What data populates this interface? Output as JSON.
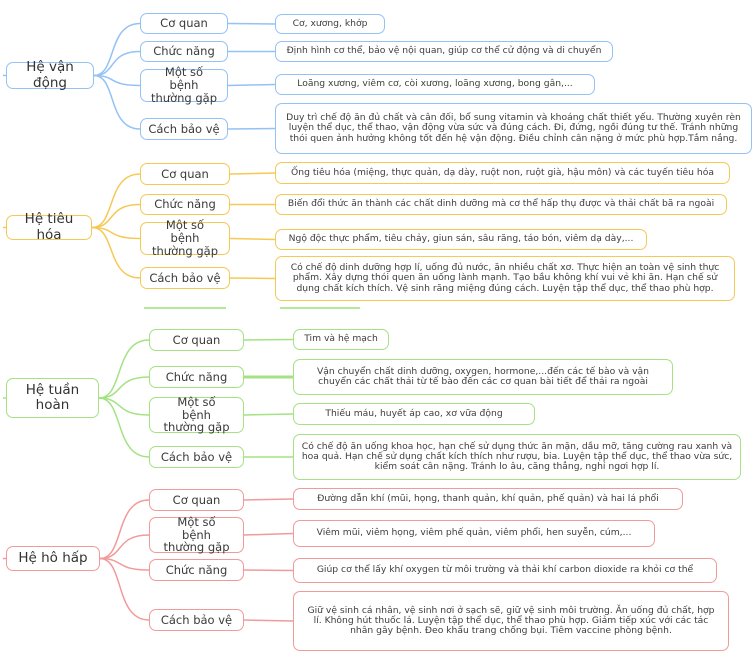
{
  "colors": {
    "he_van_dong": "#94c2f5",
    "he_tieu_hoa": "#f5c955",
    "he_tuan_hoan": "#a4e283",
    "he_ho_hap": "#f19a9a"
  },
  "systems": [
    {
      "title": "Hệ vận động",
      "color_key": "he_van_dong",
      "branches": [
        {
          "label": "Cơ quan",
          "detail": "Cơ, xương, khớp"
        },
        {
          "label": "Chức năng",
          "detail": "Định hình cơ thể, bảo vệ nội quan, giúp cơ thể cử động và di chuyển"
        },
        {
          "label": "Một số bệnh thường gặp",
          "detail": "Loãng xương, viêm cơ, còi xương, loãng xương, bong gân,..."
        },
        {
          "label": "Cách bảo vệ",
          "detail": "Duy trì chế độ ăn đủ chất và cân đối, bổ sung vitamin và khoáng chất thiết yếu. Thường xuyên rèn luyện thể dục, thể thao, vận động vừa sức và đúng cách. Đi, đứng, ngồi đúng tư thế. Tránh những thói quen ảnh hưởng không tốt đến hệ vận động. Điều chỉnh cân nặng ở mức phù hợp.Tắm nắng."
        }
      ]
    },
    {
      "title": "Hệ tiêu hóa",
      "color_key": "he_tieu_hoa",
      "branches": [
        {
          "label": "Cơ quan",
          "detail": "Ống tiêu hóa (miệng, thực quản, dạ dày, ruột non, ruột già, hậu môn) và các tuyến tiêu hóa"
        },
        {
          "label": "Chức năng",
          "detail": "Biến đổi thức ăn thành các chất dinh dưỡng mà cơ thể hấp thụ được và thải chất bã ra ngoài"
        },
        {
          "label": "Một số bệnh thường gặp",
          "detail": "Ngộ độc thực phẩm, tiêu chảy, giun sán, sâu răng, táo bón, viêm dạ dày,..."
        },
        {
          "label": "Cách bảo vệ",
          "detail": "Có chế độ dinh dưỡng hợp lí, uống đủ nước, ăn nhiều chất xơ.  Thực hiện an toàn vệ sinh thực phẩm.  Xây dựng thói quen ăn uống lành mạnh.  Tạo bầu không khí vui vẻ khi ăn. Hạn chế sử dụng chất kích thích.  Vệ sinh răng miệng đúng cách.  Luyện tập thể dục, thể thao phù hợp."
        }
      ]
    },
    {
      "title": "Hệ tuần hoàn",
      "color_key": "he_tuan_hoan",
      "branches": [
        {
          "label": "Cơ quan",
          "detail": "Tim và hệ mạch"
        },
        {
          "label": "Chức năng",
          "detail": "Vận chuyển chất dinh dưỡng, oxygen, hormone,...đến các tế bào và vận chuyển các chất thải từ tế bào đến các cơ quan bài tiết để thải ra ngoài"
        },
        {
          "label": "Một số bệnh thường gặp",
          "detail": "Thiếu máu, huyết áp cao, xơ vữa động"
        },
        {
          "label": "Cách bảo vệ",
          "detail": "Có chế độ ăn uống khoa học, hạn chế sử dụng thức ăn mặn, dầu mỡ, tăng cường rau xanh và hoa quả.  Hạn chế sử dụng chất kích thích như rượu, bia.   Luyện tập thể dục, thể thao vừa sức, kiểm soát cân nặng.  Tránh lo âu, căng thẳng, nghỉ ngơi hợp lí."
        }
      ]
    },
    {
      "title": "Hệ hô hấp",
      "color_key": "he_ho_hap",
      "branches": [
        {
          "label": "Cơ quan",
          "detail": "Đường dẫn khí (mũi, họng, thanh quản, khí quản, phế quản) và hai lá phổi"
        },
        {
          "label": "Một số bệnh thường gặp",
          "detail": "Viêm mũi, viêm họng, viêm phế quản, viêm phổi, hen suyễn, cúm,..."
        },
        {
          "label": "Chức năng",
          "detail": "Giúp cơ thể lấy khí oxygen từ môi trường và thải khí carbon dioxide ra khỏi cơ thể"
        },
        {
          "label": "Cách bảo vệ",
          "detail": "Giữ vệ sinh cá nhân, vệ sinh nơi ở sạch sẽ, giữ vệ sinh môi trường. Ăn uống đủ chất, hợp lí. Không hút thuốc lá. Luyện tập thể dục, thể thao phù hợp. Giảm tiếp xúc với các tác nhân gây bệnh. Đeo khẩu trang chống bụi. Tiêm vaccine phòng bệnh."
        }
      ]
    }
  ]
}
